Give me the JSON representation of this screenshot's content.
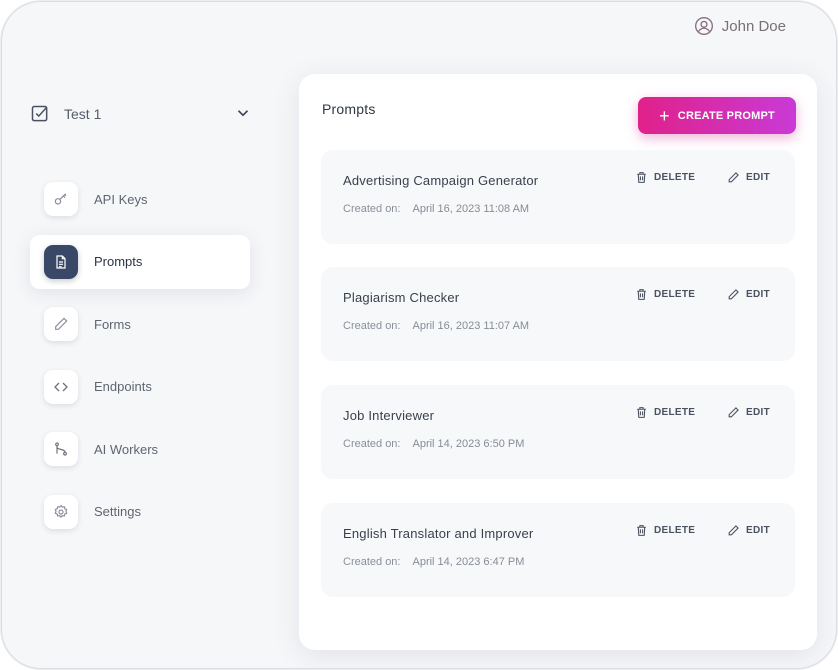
{
  "header": {
    "user_name": "John Doe"
  },
  "project_selector": {
    "name": "Test 1"
  },
  "sidebar": {
    "items": [
      {
        "label": "API Keys",
        "icon": "key-icon",
        "active": false
      },
      {
        "label": "Prompts",
        "icon": "document-icon",
        "active": true
      },
      {
        "label": "Forms",
        "icon": "pencil-icon",
        "active": false
      },
      {
        "label": "Endpoints",
        "icon": "code-brackets-icon",
        "active": false
      },
      {
        "label": "AI Workers",
        "icon": "git-branch-icon",
        "active": false
      },
      {
        "label": "Settings",
        "icon": "gear-icon",
        "active": false
      }
    ]
  },
  "main": {
    "title": "Prompts",
    "create_label": "CREATE PROMPT",
    "created_on_label": "Created on:",
    "delete_label": "DELETE",
    "edit_label": "EDIT",
    "prompts": [
      {
        "name": "Advertising Campaign Generator",
        "created": "April 16, 2023 11:08 AM"
      },
      {
        "name": "Plagiarism Checker",
        "created": "April 16, 2023 11:07 AM"
      },
      {
        "name": "Job Interviewer",
        "created": "April 14, 2023 6:50 PM"
      },
      {
        "name": "English Translator and Improver",
        "created": "April 14, 2023 6:47 PM"
      }
    ]
  },
  "colors": {
    "accent_start": "#e0218a",
    "accent_end": "#c93ad6",
    "active_icon_bg": "#3a4868"
  }
}
